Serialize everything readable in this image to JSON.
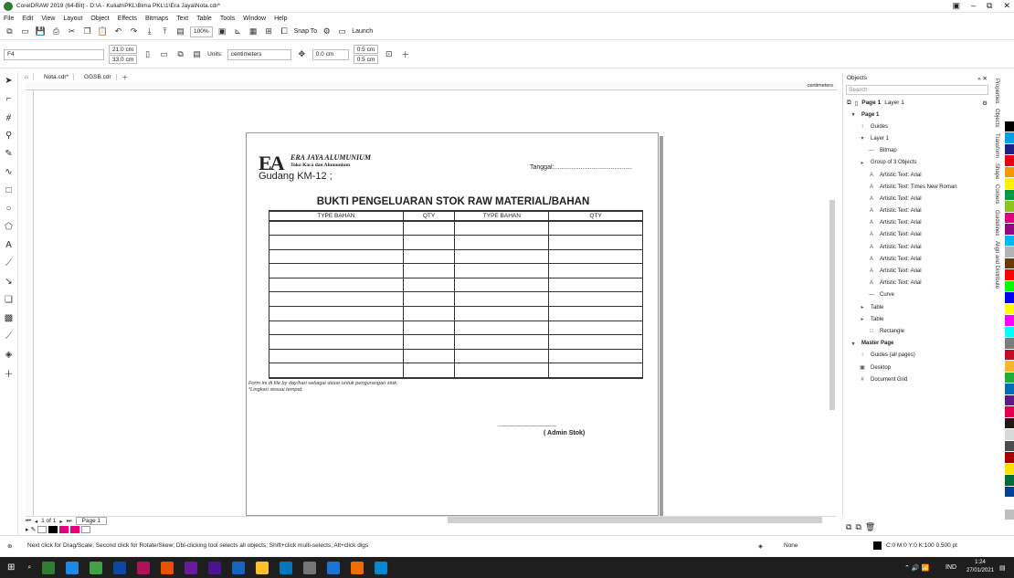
{
  "window": {
    "title": "CorelDRAW 2019 (64-Bit) - D:\\A - Kuliah\\PKL\\Bima PKL\\1\\Era Jaya\\Nota.cdr*",
    "controls": [
      "▣",
      "–",
      "⧉",
      "✕"
    ]
  },
  "menu": [
    "File",
    "Edit",
    "View",
    "Layout",
    "Object",
    "Effects",
    "Bitmaps",
    "Text",
    "Table",
    "Tools",
    "Window",
    "Help"
  ],
  "toolbar": {
    "zoom": "100%",
    "snap": "Snap To",
    "launch": "Launch"
  },
  "propbar": {
    "paper": "F4",
    "width": "21.0 cm",
    "height": "33.0 cm",
    "units_label": "Units:",
    "units": "centimeters",
    "nudge": "0.0 cm",
    "dup_x": "0.5 cm",
    "dup_y": "0.5 cm"
  },
  "doc_tabs": [
    "Nota.cdr*",
    "GGSB.cdr"
  ],
  "ruler_unit": "centimeters",
  "nota": {
    "logo_mark": "EA",
    "company": "ERA JAYA ALUMUNIUM",
    "tagline": "Toko Kaca dan Alumunium",
    "gudang": "Gudang KM-12 ;",
    "tanggal": "Tanggal:............................................",
    "heading": "BUKTI PENGELUARAN STOK RAW MATERIAL/BAHAN",
    "columns": [
      "TYPE BAHAN",
      "QTY",
      "TYPE BAHAN",
      "QTY"
    ],
    "row_count": 11,
    "note1": "Form ini di file by day/hari sebagai dasar untuk pengurangan stok.",
    "note2": "*Lingkari sesuai tempat.",
    "signature_line": "........................................................................",
    "signature": "( Admin Stok)"
  },
  "page_nav": {
    "label": "1 of 1",
    "page_tab": "Page 1"
  },
  "objects_panel": {
    "title": "Objects",
    "search_placeholder": "Search",
    "page_label": "Page 1",
    "layer_label": "Layer 1",
    "items": [
      {
        "icon": "▾",
        "label": "Page 1",
        "indent": 0,
        "section": true
      },
      {
        "icon": "↑",
        "label": "Guides",
        "indent": 1,
        "section": false
      },
      {
        "icon": "▾",
        "label": "Layer 1",
        "indent": 1,
        "section": false
      },
      {
        "icon": "—",
        "label": "Bitmap",
        "indent": 2,
        "section": false
      },
      {
        "icon": "▸",
        "label": "Group of 3 Objects",
        "indent": 1,
        "section": false
      },
      {
        "icon": "A",
        "label": "Artistic Text: Arial",
        "indent": 2,
        "section": false
      },
      {
        "icon": "A",
        "label": "Artistic Text: Times New Roman",
        "indent": 2,
        "section": false
      },
      {
        "icon": "A",
        "label": "Artistic Text: Arial",
        "indent": 2,
        "section": false
      },
      {
        "icon": "A",
        "label": "Artistic Text: Arial",
        "indent": 2,
        "section": false
      },
      {
        "icon": "A",
        "label": "Artistic Text: Arial",
        "indent": 2,
        "section": false
      },
      {
        "icon": "A",
        "label": "Artistic Text: Arial",
        "indent": 2,
        "section": false
      },
      {
        "icon": "A",
        "label": "Artistic Text: Arial",
        "indent": 2,
        "section": false
      },
      {
        "icon": "A",
        "label": "Artistic Text: Arial",
        "indent": 2,
        "section": false
      },
      {
        "icon": "A",
        "label": "Artistic Text: Arial",
        "indent": 2,
        "section": false
      },
      {
        "icon": "A",
        "label": "Artistic Text: Arial",
        "indent": 2,
        "section": false
      },
      {
        "icon": "—",
        "label": "Curve",
        "indent": 2,
        "section": false
      },
      {
        "icon": "▸",
        "label": "Table",
        "indent": 1,
        "section": false
      },
      {
        "icon": "▸",
        "label": "Table",
        "indent": 1,
        "section": false
      },
      {
        "icon": "□",
        "label": "Rectangle",
        "indent": 2,
        "section": false
      },
      {
        "icon": "▾",
        "label": "Master Page",
        "indent": 0,
        "section": true
      },
      {
        "icon": "↑",
        "label": "Guides (all pages)",
        "indent": 1,
        "section": false
      },
      {
        "icon": "▣",
        "label": "Desktop",
        "indent": 1,
        "section": false
      },
      {
        "icon": "#",
        "label": "Document Grid",
        "indent": 1,
        "section": false
      }
    ]
  },
  "side_tabs": [
    "Properties",
    "Objects",
    "Transform",
    "Shape",
    "Corners",
    "Guidelines",
    "Align and Distribute"
  ],
  "palette_colors": [
    "#ffffff",
    "#000000",
    "#00a0e9",
    "#1d2088",
    "#e60012",
    "#f39800",
    "#fff100",
    "#009944",
    "#8fc31f",
    "#e4007f",
    "#920783",
    "#00b7ee",
    "#b3b3b3",
    "#6a3906",
    "#ff0000",
    "#00ff00",
    "#0000ff",
    "#ffff00",
    "#ff00ff",
    "#00ffff",
    "#7d7d7d",
    "#c30d23",
    "#f8b62d",
    "#22ac38",
    "#036eb8",
    "#601986",
    "#e5004f",
    "#231815",
    "#d9d9d9",
    "#4d4d4d",
    "#a40000",
    "#ffe100",
    "#006e3a",
    "#004098",
    "#ffffff",
    "#bfbfbf"
  ],
  "status": {
    "hint": "Next click for Drag/Scale; Second click for Rotate/Skew; Dbl-clicking tool selects all objects; Shift+click multi-selects; Alt+click digs",
    "fill": "None",
    "outline": "C:0 M:0 Y:0 K:100  0.500 pt"
  },
  "taskbar": {
    "lang": "IND",
    "time": "1:24",
    "date": "27/01/2021"
  }
}
